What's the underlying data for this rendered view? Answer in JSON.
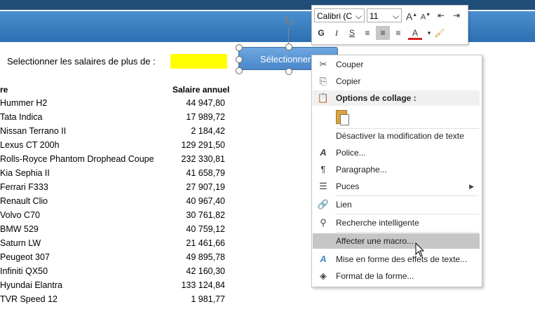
{
  "prompt": {
    "label": "Selectionner les salaires de plus de :",
    "value": ""
  },
  "shape_button": {
    "label": "Sélectionner"
  },
  "table": {
    "headers": {
      "name": "re",
      "salary": "Salaire annuel"
    },
    "rows": [
      {
        "name": "Hummer H2",
        "salary": "44 947,80"
      },
      {
        "name": "Tata Indica",
        "salary": "17 989,72"
      },
      {
        "name": "Nissan Terrano II",
        "salary": "2 184,42"
      },
      {
        "name": "Lexus CT 200h",
        "salary": "129 291,50"
      },
      {
        "name": "Rolls-Royce Phantom Drophead Coupe",
        "salary": "232 330,81"
      },
      {
        "name": "Kia Sephia II",
        "salary": "41 658,79"
      },
      {
        "name": "Ferrari F333",
        "salary": "27 907,19"
      },
      {
        "name": "Renault Clio",
        "salary": "40 967,40"
      },
      {
        "name": "Volvo C70",
        "salary": "30 761,82"
      },
      {
        "name": "BMW 529",
        "salary": "40 759,12"
      },
      {
        "name": "Saturn LW",
        "salary": "21 461,66"
      },
      {
        "name": "Peugeot 307",
        "salary": "49 895,78"
      },
      {
        "name": "Infiniti QX50",
        "salary": "42 160,30"
      },
      {
        "name": "Hyundai Elantra",
        "salary": "133 124,84"
      },
      {
        "name": "TVR Speed 12",
        "salary": "1 981,77"
      }
    ]
  },
  "mini_toolbar": {
    "font_name": "Calibri (C",
    "font_size": "11",
    "bold": "G",
    "italic": "I",
    "shadow": "S",
    "grow": "A",
    "shrink": "A",
    "font_color": "A"
  },
  "context_menu": {
    "items": [
      {
        "label": "Couper",
        "icon": "scissors-icon"
      },
      {
        "label": "Copier",
        "icon": "copy-icon"
      },
      {
        "label": "Options de collage :",
        "icon": "paste-icon"
      },
      {
        "label": "Désactiver la modification de texte",
        "icon": ""
      },
      {
        "label": "Police...",
        "icon": "font-icon"
      },
      {
        "label": "Paragraphe...",
        "icon": "paragraph-icon"
      },
      {
        "label": "Puces",
        "icon": "bullets-icon"
      },
      {
        "label": "Lien",
        "icon": "link-icon"
      },
      {
        "label": "Recherche intelligente",
        "icon": "smart-lookup-icon"
      },
      {
        "label": "Affecter une macro...",
        "icon": ""
      },
      {
        "label": "Mise en forme des effets de texte...",
        "icon": "text-effects-icon"
      },
      {
        "label": "Format de la forme...",
        "icon": "format-shape-icon"
      }
    ],
    "highlighted_index": 9
  },
  "colors": {
    "header_dark": "#1f4e79",
    "header_band": "#2d6fb2",
    "input_fill": "#ffff00",
    "button_fill": "#5b9bd5",
    "menu_highlight": "#c6c6c6"
  }
}
